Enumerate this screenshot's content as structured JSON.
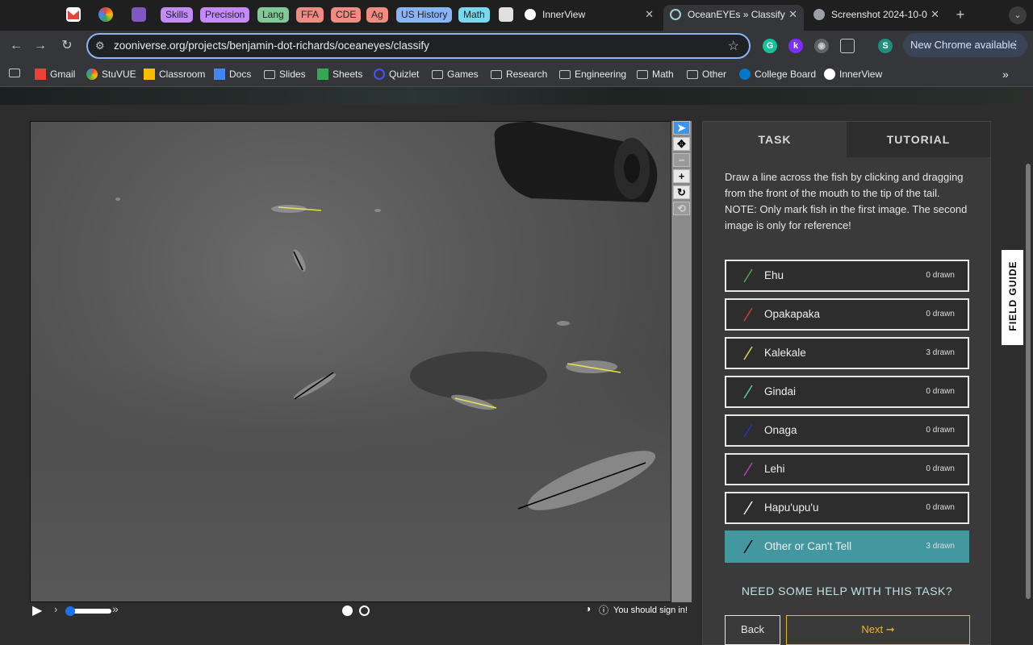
{
  "tabs": {
    "groups": [
      {
        "label": "Skills",
        "color": "#c58af9"
      },
      {
        "label": "Precision",
        "color": "#c58af9"
      },
      {
        "label": "Lang",
        "color": "#81c995"
      },
      {
        "label": "FFA",
        "color": "#f28b82"
      },
      {
        "label": "CDE",
        "color": "#f28b82"
      },
      {
        "label": "Ag",
        "color": "#f28b82"
      },
      {
        "label": "US History",
        "color": "#8ab4f8"
      },
      {
        "label": "Math",
        "color": "#78d9ec"
      }
    ],
    "open": [
      {
        "title": "InnerView",
        "icon": "innerview-icon"
      },
      {
        "title": "OceanEYEs » Classify",
        "icon": "zooniverse-icon"
      },
      {
        "title": "Screenshot 2024-10-0",
        "icon": "globe-icon"
      }
    ]
  },
  "toolbar": {
    "url": "zooniverse.org/projects/benjamin-dot-richards/oceaneyes/classify",
    "profile_initial": "S",
    "new_chrome_label": "New Chrome available"
  },
  "bookmarks": [
    {
      "label": "Gmail",
      "icon": "gmail-icon"
    },
    {
      "label": "StuVUE",
      "icon": "stuvue-icon"
    },
    {
      "label": "Classroom",
      "icon": "classroom-icon"
    },
    {
      "label": "Docs",
      "icon": "docs-icon"
    },
    {
      "label": "Slides",
      "icon": "folder-icon"
    },
    {
      "label": "Sheets",
      "icon": "sheets-icon"
    },
    {
      "label": "Quizlet",
      "icon": "quizlet-icon"
    },
    {
      "label": "Games",
      "icon": "folder-icon"
    },
    {
      "label": "Research",
      "icon": "folder-icon"
    },
    {
      "label": "Engineering",
      "icon": "folder-icon"
    },
    {
      "label": "Math",
      "icon": "folder-icon"
    },
    {
      "label": "Other",
      "icon": "folder-icon"
    },
    {
      "label": "College Board",
      "icon": "collegeboard-icon"
    },
    {
      "label": "InnerView",
      "icon": "innerview-icon"
    }
  ],
  "task_panel": {
    "tab_task": "TASK",
    "tab_tutorial": "TUTORIAL",
    "instruction_1": "Draw a line across the fish by clicking and dragging from the front of the mouth to the tip of the tail.",
    "instruction_2": "NOTE: Only mark fish in the first image. The second image is only for reference!",
    "choices": [
      {
        "label": "Ehu",
        "count": "0 drawn",
        "color": "#4caf50"
      },
      {
        "label": "Opakapaka",
        "count": "0 drawn",
        "color": "#e53935"
      },
      {
        "label": "Kalekale",
        "count": "3 drawn",
        "color": "#e6e04a"
      },
      {
        "label": "Gindai",
        "count": "0 drawn",
        "color": "#4fd1c5"
      },
      {
        "label": "Onaga",
        "count": "0 drawn",
        "color": "#2233cc"
      },
      {
        "label": "Lehi",
        "count": "0 drawn",
        "color": "#c33ac9"
      },
      {
        "label": "Hapu'upu'u",
        "count": "0 drawn",
        "color": "#ffffff"
      },
      {
        "label": "Other or Can't Tell",
        "count": "3 drawn",
        "color": "#000000",
        "selected": true
      }
    ],
    "help_text": "NEED SOME HELP WITH THIS TASK?",
    "back_label": "Back",
    "next_label": "Next ➞"
  },
  "viewer": {
    "sign_in_text": "You should sign in!",
    "frames": 2
  },
  "field_guide_label": "FIELD GUIDE"
}
